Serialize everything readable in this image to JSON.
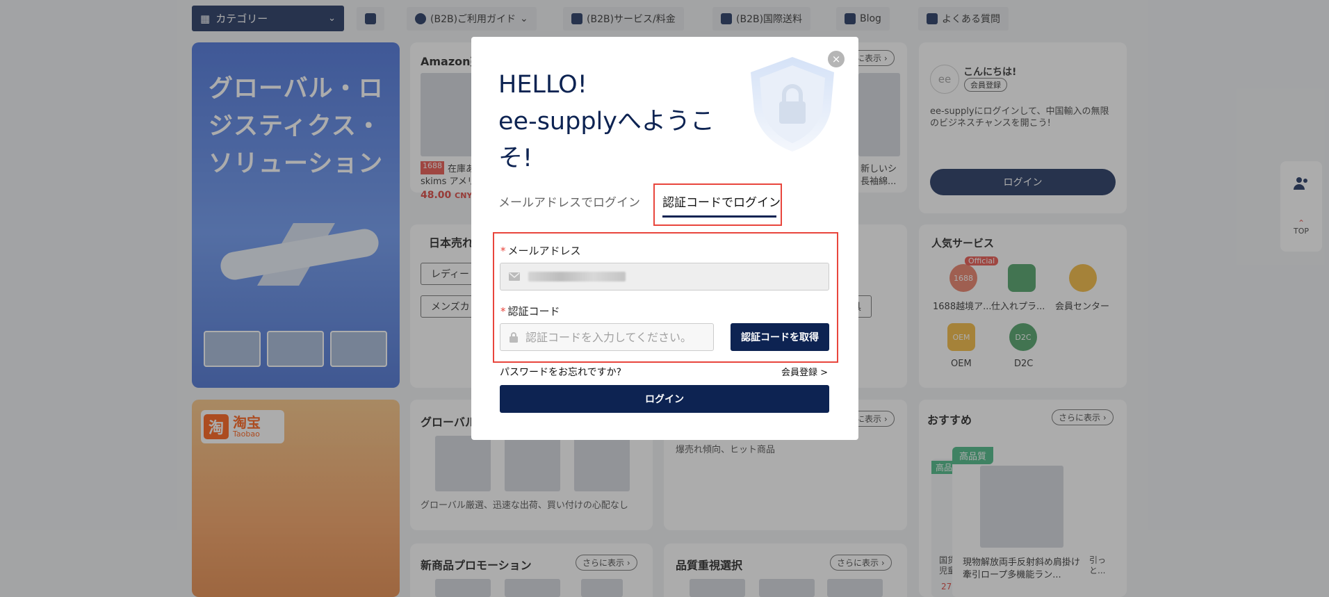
{
  "nav": {
    "category_label": "カテゴリー",
    "items": [
      {
        "label": "(B2B)ご利用ガイド"
      },
      {
        "label": "(B2B)サービス/料金"
      },
      {
        "label": "(B2B)国際送料"
      },
      {
        "label": "Blog"
      },
      {
        "label": "よくある質問"
      }
    ]
  },
  "banner": {
    "title_lines": [
      "グローバル・ロ",
      "ジスティクス・",
      "ソリューション"
    ],
    "taobao_name": "淘宝",
    "taobao_sub": "Taobao",
    "taobao_icon": "淘"
  },
  "amazon_card": {
    "title": "Amazon売",
    "more": "に表示 ›",
    "badge": "1688",
    "product_text": "在庫あ",
    "product_text2": "skims アメリ",
    "price": "48.00",
    "currency": "CNY",
    "right_text1": "新しいシ",
    "right_text2": "長袖綿..."
  },
  "japan_card": {
    "title": "日本売れ",
    "chip1": "レディー",
    "chip2": "メンズカ",
    "chip3": "具"
  },
  "global_card": {
    "title": "グローバル",
    "more": "に表示 ›",
    "desc": "グローバル厳選、迅速な出荷、買い付けの心配なし"
  },
  "trend_card": {
    "desc": "爆売れ傾向、ヒット商品"
  },
  "promo_card": {
    "title": "新商品プロモーション",
    "more": "さらに表示 ›"
  },
  "quality_card": {
    "title": "品質重視選択",
    "more": "さらに表示 ›"
  },
  "user_card": {
    "greeting": "こんにちは!",
    "badge": "会員登録",
    "desc": "ee-supplyにログインして、中国輸入の無限のビジネスチャンスを開こう!",
    "login": "ログイン"
  },
  "popular_card": {
    "title": "人気サービス",
    "services": [
      {
        "label": "1688越境ア...",
        "icon": "1688",
        "tag": "Official",
        "color": "#e8745a"
      },
      {
        "label": "仕入れプラ...",
        "icon": "",
        "color": "#3e9a5a"
      },
      {
        "label": "会員センター",
        "icon": "",
        "color": "#f2b32f"
      },
      {
        "label": "OEM",
        "icon": "OEM",
        "color": "#f2b32f"
      },
      {
        "label": "D2C",
        "icon": "D2C",
        "color": "#3e9a5a"
      }
    ]
  },
  "recommend_card": {
    "title": "おすすめ",
    "more": "さらに表示 ›",
    "tag": "高品質",
    "tag_back": "高品",
    "product": "現物解放両手反射斜め肩掛け牽引ロープ多機能ラン...",
    "side_text1": "国货",
    "side_text2": "児童",
    "side_text3": "引っ",
    "side_text4": "と...",
    "price_frag": "27."
  },
  "side_widget": {
    "top": "TOP"
  },
  "modal": {
    "heading_lines": [
      "HELLO!",
      "ee-supplyへようこ",
      "そ!"
    ],
    "tab_email": "メールアドレスでログイン",
    "tab_code": "認証コードでログイン",
    "email_label": "メールアドレス",
    "code_label": "認証コード",
    "code_placeholder": "認証コードを入力してください。",
    "get_code": "認証コードを取得",
    "forgot": "パスワードをお忘れですか?",
    "register": "会員登録 >",
    "login": "ログイン",
    "close": "×"
  }
}
